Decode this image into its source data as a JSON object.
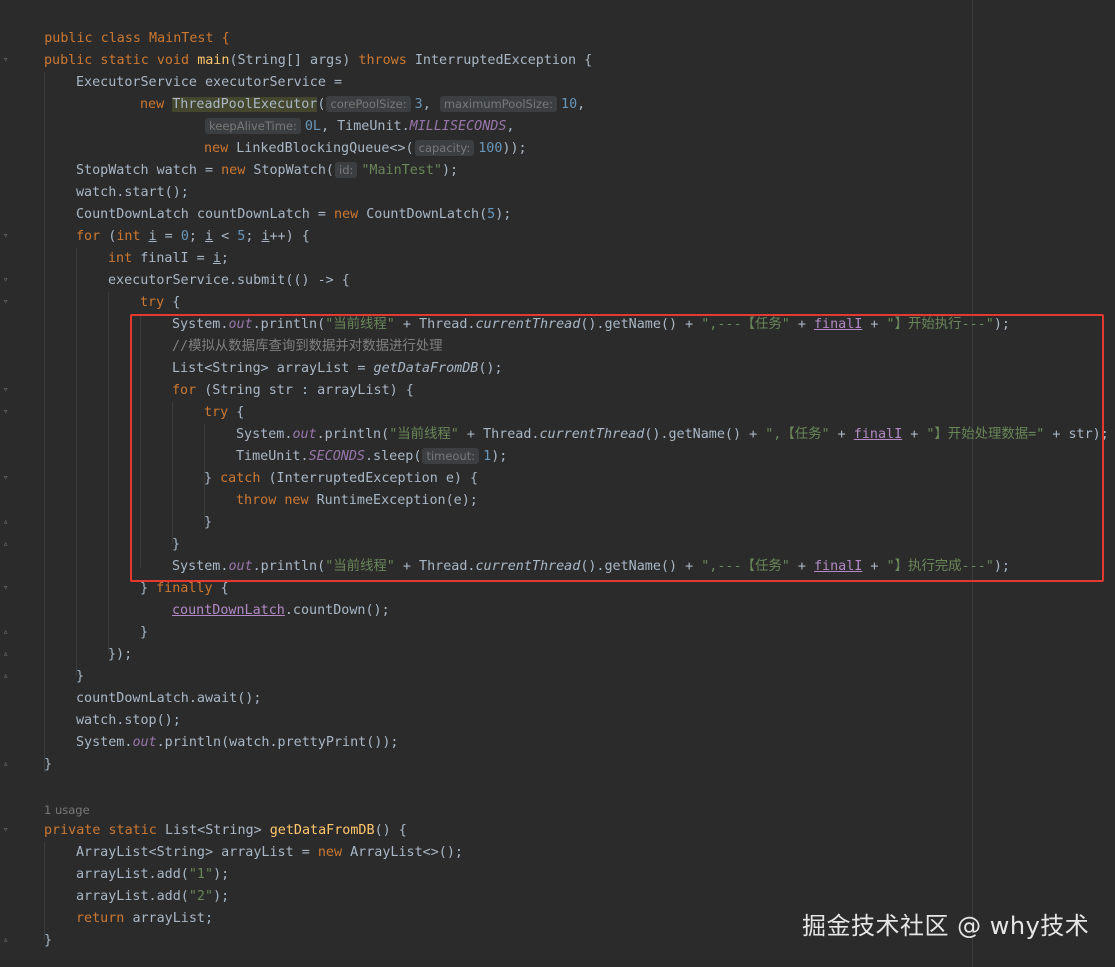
{
  "editor": {
    "usage_hint": "1 usage",
    "watermark": "掘金技术社区 @ why技术",
    "code": {
      "class_decl": "public class MainTest {",
      "main_sig": "public static void main(String[] args) throws InterruptedException {",
      "l3": "ExecutorService executorService =",
      "l4_pre": "new ",
      "l4_ctor": "ThreadPoolExecutor",
      "l4_paren": "(",
      "hint_core": "corePoolSize:",
      "l4_core_val": "3",
      "hint_max": "maximumPoolSize:",
      "l4_max_val": "10",
      "hint_keepalive": "keepAliveTime:",
      "l5_keep": "0L",
      "l5_unit": "TimeUnit.",
      "l5_ms": "MILLISECONDS",
      "l6_new": "new ",
      "l6_q": "LinkedBlockingQueue<>(",
      "hint_capacity": "capacity:",
      "l6_cap": "100",
      "l6_end": "));",
      "l7_a": "StopWatch watch = ",
      "l7_b": "StopWatch(",
      "hint_id": "id:",
      "l7_str": "\"MainTest\"",
      "l8": "watch.start();",
      "l9_a": "CountDownLatch countDownLatch = ",
      "l9_b": "CountDownLatch(",
      "l9_num": "5",
      "l9_end": ");",
      "l10_for": "for ",
      "l10_int": "int ",
      "l10_i": "i",
      "l10_zero": "0",
      "l10_five": "5",
      "l11_int": "int ",
      "l11_rest": "finalI = ",
      "l12": "executorService.submit(() -> {",
      "l13_try": "try ",
      "print_sys": "System.",
      "print_out": "out",
      "print_ln": ".println(",
      "str_cur": "\"当前线程\"",
      "thread_a": " + Thread.",
      "thread_cur": "currentThread",
      "thread_b": "().getName() + ",
      "str_task1": "\",---【任务\"",
      "plus": " + ",
      "finali": "finalI",
      "str_start": "\"】开始执行---\"",
      "close_paren": ");",
      "comment": "//模拟从数据库查询到数据并对数据进行处理",
      "l16_a": "List<String> arrayList = ",
      "l16_fn": "getDataFromDB",
      "l16_end": "();",
      "l17_rest": "(String str : arrayList) {",
      "l18_try": "try ",
      "str_task2": "\",【任务\"",
      "str_process": "\"】开始处理数据=\"",
      "l19_end": " + str);",
      "l20_a": "TimeUnit.",
      "l20_sec": "SECONDS",
      "l20_b": ".sleep(",
      "hint_timeout": "timeout:",
      "l20_one": "1",
      "l21_a": "} ",
      "l21_catch": "catch ",
      "l21_b": "(InterruptedException e) {",
      "l22_throw": "throw new ",
      "l22_b": "RuntimeException(e);",
      "str_done": "\"】执行完成---\"",
      "l26_a": "} ",
      "l26_finally": "finally ",
      "l27_fld": "countDownLatch",
      "l27_b": ".countDown();",
      "l29": "});",
      "l31": "countDownLatch.await();",
      "l32": "watch.stop();",
      "l33_b": ".println(watch.prettyPrint());",
      "m2_kw": "private static ",
      "m2_type": "List<String> ",
      "m2_fn": "getDataFromDB",
      "m2_end": "() {",
      "m3_a": "ArrayList<String> arrayList = ",
      "m3_b": "ArrayList<>();",
      "m4_a": "arrayList.add(",
      "s1": "\"1\"",
      "s2": "\"2\"",
      "m6_ret": "return ",
      "m6_b": "arrayList;",
      "rbrace": "}"
    }
  }
}
